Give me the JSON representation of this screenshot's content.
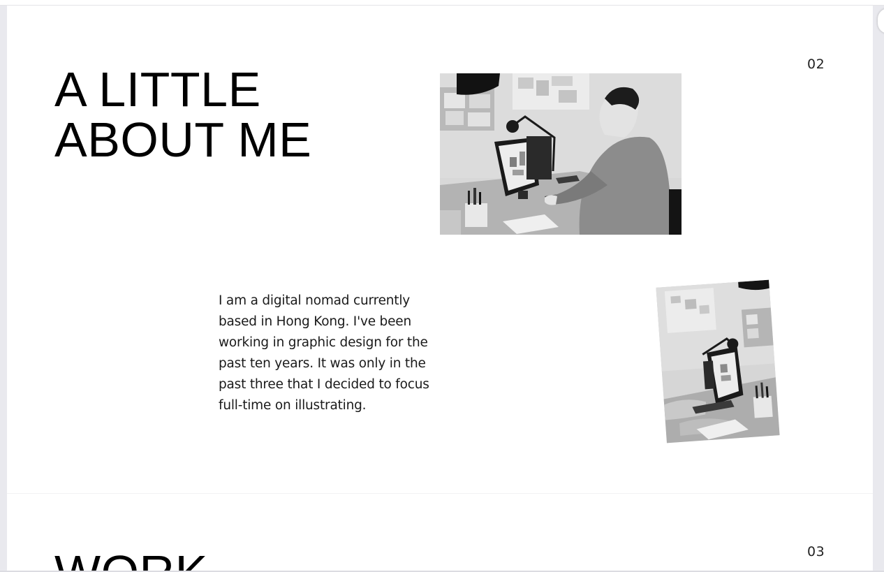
{
  "about_section": {
    "number": "02",
    "heading_line1": "A LITTLE",
    "heading_line2": "ABOUT ME",
    "bio_lines": [
      "I am a digital nomad currently",
      "based in Hong Kong. I've been",
      "working in graphic design for the",
      "past ten years. It was only in the",
      "past three that I decided to focus",
      "full-time on illustrating."
    ],
    "main_photo": "Black and white photo of a man working at a desk with a computer monitor and lamp",
    "small_photo": "Tilted black and white photo of a desk with a computer monitor, lamp and pen cup"
  },
  "work_section": {
    "number": "03",
    "heading": "WORK"
  },
  "colors": {
    "background": "#ffffff",
    "frame": "#e9e9ee",
    "text": "#000000"
  }
}
